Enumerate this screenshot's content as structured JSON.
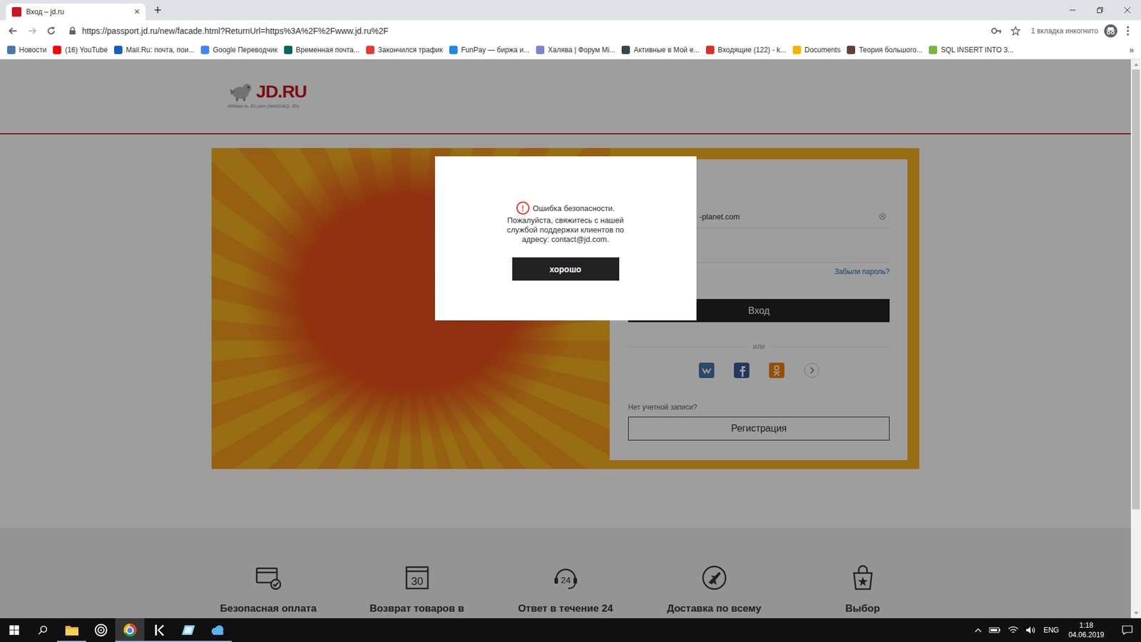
{
  "browser": {
    "tab": {
      "title": "Вход – jd.ru",
      "close": "×",
      "selected": true
    },
    "new_tab": "+",
    "nav": {
      "back_disabled": false,
      "forward_disabled": true
    },
    "url": "https://passport.jd.ru/new/facade.html?ReturnUrl=https%3A%2F%2Fwww.jd.ru%2F",
    "incognito": "1 вкладка инкогнито",
    "bookmarks": [
      {
        "label": "Новости",
        "color": "#4a76a8"
      },
      {
        "label": "(16) YouTube",
        "color": "#ff0000"
      },
      {
        "label": "Mail.Ru: почта, пои...",
        "color": "#1a5fb4"
      },
      {
        "label": "Google Переводчик",
        "color": "#4285f4"
      },
      {
        "label": "Временная почта...",
        "color": "#00695c"
      },
      {
        "label": "Закончился трафик",
        "color": "#e53935"
      },
      {
        "label": "FunPay — биржа и...",
        "color": "#1e88e5"
      },
      {
        "label": "Халява | Форум Mi...",
        "color": "#7986cb"
      },
      {
        "label": "Активные в Мой е...",
        "color": "#37474f"
      },
      {
        "label": "Входящие (122) - k...",
        "color": "#d93025"
      },
      {
        "label": "Documents",
        "color": "#f4b400"
      },
      {
        "label": "Теория большого...",
        "color": "#5d4037"
      },
      {
        "label": "SQL INSERT INTO 3...",
        "color": "#7cb342"
      }
    ],
    "bookmarks_more": "»"
  },
  "page": {
    "logo": {
      "name": "JD.RU",
      "tagline": "Affiliate to JD.com (NASDAQ: JD)"
    },
    "login": {
      "email_value": "-planet.com",
      "forgot": "Забыли пароль?",
      "submit": "Вход",
      "or": "или",
      "no_account": "Нет учетной записи?",
      "register": "Регистрация"
    },
    "features": [
      {
        "kind": "payment",
        "label": "Безопасная оплата"
      },
      {
        "kind": "return",
        "label": "Возврат товаров в",
        "badge": "30"
      },
      {
        "kind": "support",
        "label": "Ответ в течение 24",
        "badge": "24"
      },
      {
        "kind": "delivery",
        "label": "Доставка по всему"
      },
      {
        "kind": "choice",
        "label": "Выбор"
      }
    ]
  },
  "dialog": {
    "icon": "!",
    "title": "Ошибка безопасности.",
    "message": "Пожалуйста, свяжитесь с нашей службой поддержки клиентов по адресу: contact@jd.com.",
    "button": "хорошо"
  },
  "taskbar": {
    "apps": [
      {
        "kind": "explorer",
        "selected": false,
        "running": true
      },
      {
        "kind": "target",
        "selected": false,
        "running": false
      },
      {
        "kind": "chrome",
        "selected": true,
        "running": true
      },
      {
        "kind": "kbird",
        "selected": false,
        "running": true
      },
      {
        "kind": "notes",
        "selected": false,
        "running": true
      },
      {
        "kind": "cloud",
        "selected": false,
        "running": true
      }
    ],
    "lang": "ENG",
    "time": "1:18",
    "date": "04.06.2019"
  }
}
